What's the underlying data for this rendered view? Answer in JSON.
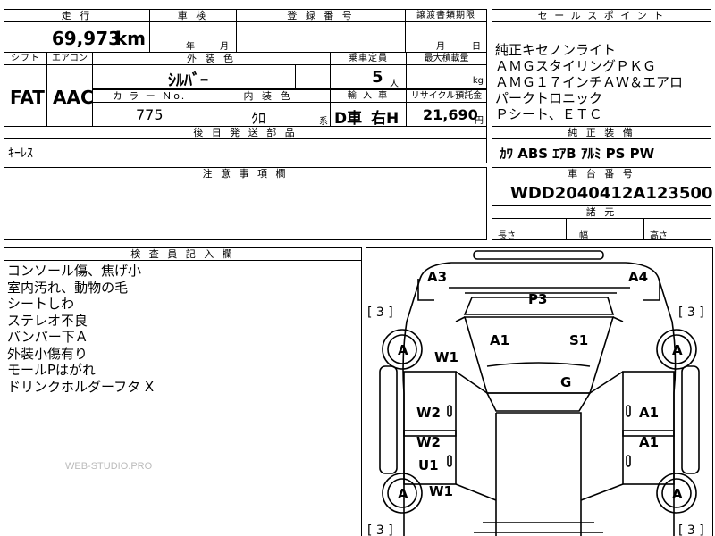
{
  "top_row": {
    "odometer_header": "走 行",
    "inspection_header": "車 検",
    "registration_header": "登 録 番 号",
    "transfer_deadline_header": "譲渡書類期限",
    "odometer_value": "69,973",
    "odometer_unit": "km",
    "year_label": "年",
    "month_label": "月",
    "transfer_month_label": "月",
    "transfer_day_label": "日"
  },
  "specs": {
    "shift_header": "シフト",
    "aircon_header": "エアコン",
    "exterior_color_header": "外 装 色",
    "capacity_header": "乗車定員",
    "max_load_header": "最大積載量",
    "shift_value": "FAT",
    "aircon_value": "AAC",
    "exterior_color_value": "ｼﾙﾊﾞｰ",
    "capacity_value": "5",
    "capacity_unit": "人",
    "max_load_unit": "kg",
    "color_no_header": "カ ラ ー Ｎo.",
    "interior_color_header": "内 装 色",
    "import_header": "輸 入 車",
    "recycle_header": "リサイクル預託金",
    "color_no_value": "775",
    "interior_color_value": "ｸﾛ",
    "interior_color_suffix": "系",
    "import_dealer_value": "D車",
    "steering_value": "右H",
    "recycle_value": "21,690",
    "recycle_unit": "円",
    "later_parts_header": "後 日 発 送 部 品",
    "later_parts_value": "ｷｰﾚｽ"
  },
  "sales_points": {
    "header": "セ ー ル ス ポ イ ン ト",
    "lines": [
      "純正キセノンライト",
      "ＡＭＧスタイリングＰＫＧ",
      "ＡＭＧ１７インチＡＷ＆エアロ",
      "パークトロニック",
      "Ｐシート、ＥＴＣ"
    ]
  },
  "equipment": {
    "header": "純 正 装 備",
    "value": "ｶﾜ ABS ｴｱB ｱﾙﾐ PS PW"
  },
  "caution": {
    "header": "注 意 事 項 欄"
  },
  "chassis": {
    "header": "車 台 番 号",
    "value": "WDD2040412A123500",
    "dims_header": "諸 元",
    "length_label": "長さ",
    "width_label": "幅",
    "height_label": "高さ"
  },
  "inspector_notes": {
    "header": "検 査 員 記 入 欄",
    "lines": [
      "コンソール傷、焦げ小",
      "室内汚れ、動物の毛",
      "シートしわ",
      "ステレオ不良",
      "バンパー下Ａ",
      "外装小傷有り",
      "モールPはがれ",
      "ドリンクホルダーフタ X"
    ],
    "watermark": "WEB-STUDIO.PRO"
  },
  "diagram": {
    "marks": {
      "a3": "A3",
      "a4": "A4",
      "p3": "P3",
      "a1_roof": "A1",
      "s1": "S1",
      "g": "G",
      "w1_left": "W1",
      "w2_left_front": "W2",
      "w2_left_rear": "W2",
      "u1": "U1",
      "w1_left_rear": "W1",
      "a1_right_front": "A1",
      "a1_right_rear": "A1",
      "a_wheel_lf": "A",
      "a_wheel_rf": "A",
      "a_wheel_lr": "A",
      "a_wheel_rr": "A"
    },
    "tire_tl": "[ 3 ]",
    "tire_tr": "[ 3 ]",
    "tire_bl": "[ 3 ]",
    "tire_br": "[ 3 ]"
  }
}
